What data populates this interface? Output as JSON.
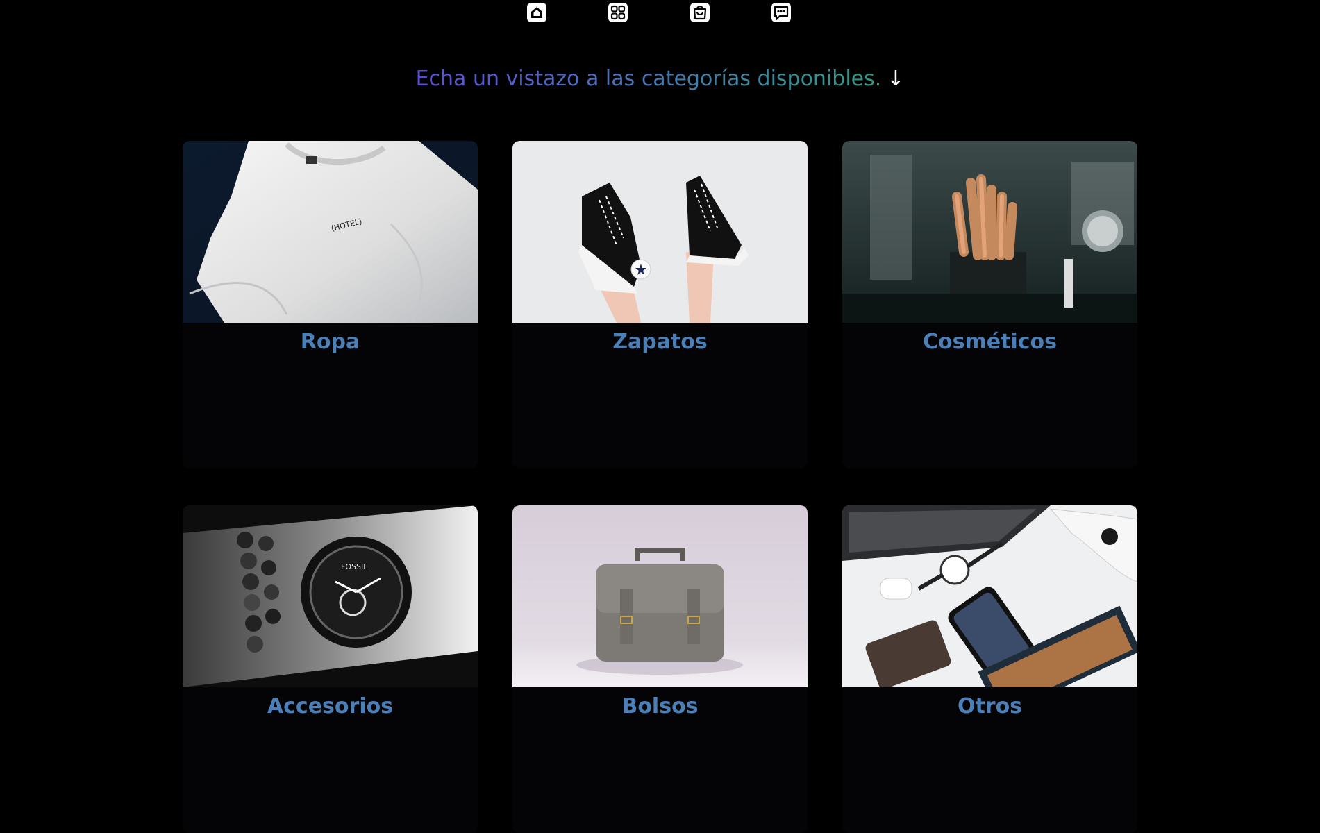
{
  "nav": {
    "items": [
      {
        "icon": "home-icon"
      },
      {
        "icon": "grid-icon"
      },
      {
        "icon": "shopping-bag-icon"
      },
      {
        "icon": "chat-icon"
      }
    ]
  },
  "heading": {
    "text": "Echa un vistazo a las categorías disponibles.",
    "arrow": "↓"
  },
  "colors": {
    "background": "#000000",
    "card_background": "#040406",
    "category_title": "#4a7fb8",
    "heading_gradient_start": "#5b4fd6",
    "heading_gradient_end": "#2f9a82"
  },
  "categories": [
    {
      "label": "Ropa",
      "image": "white-tshirt-photo"
    },
    {
      "label": "Zapatos",
      "image": "sneakers-photo"
    },
    {
      "label": "Cosméticos",
      "image": "makeup-brushes-photo"
    },
    {
      "label": "Accesorios",
      "image": "wristwatch-photo"
    },
    {
      "label": "Bolsos",
      "image": "handbag-photo"
    },
    {
      "label": "Otros",
      "image": "electronics-flatlay-photo"
    }
  ]
}
